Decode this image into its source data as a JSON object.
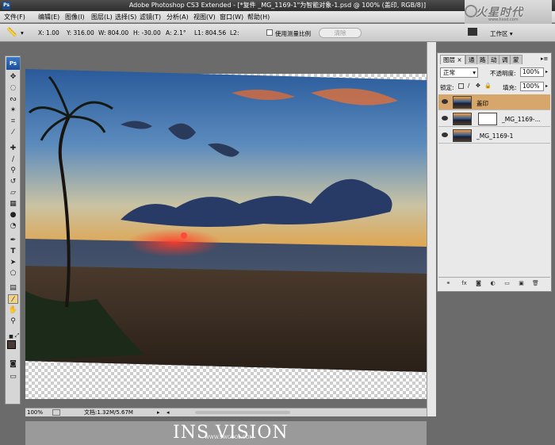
{
  "window": {
    "title": "Adobe Photoshop CS3 Extended - [*复件 _MG_1169-1\"为智能对象-1.psd @ 100% (盖印, RGB/8)]",
    "app_icon": "Ps"
  },
  "menu": [
    "文件(F)",
    "编辑(E)",
    "图像(I)",
    "图层(L)",
    "选择(S)",
    "滤镜(T)",
    "分析(A)",
    "视图(V)",
    "窗口(W)",
    "帮助(H)"
  ],
  "logo": {
    "text": "火星时代",
    "url": "www.hxsd.com"
  },
  "options": {
    "x": "X: 1.00",
    "y": "Y: 316.00",
    "w": "W: 804.00",
    "h": "H: -30.00",
    "a": "A: 2.1°",
    "l1": "L1: 804.56",
    "l2": "L2:",
    "use_scale_label": "使用测量比例",
    "clear_label": "清除",
    "workspace_label": "工作区 ▾"
  },
  "toolbox": {
    "badge": "Ps"
  },
  "panel": {
    "tabs": [
      "图层 ×",
      "通",
      "路",
      "动",
      "调",
      "蒙"
    ],
    "blend_mode": "正常",
    "opacity_label": "不透明度:",
    "opacity_value": "100%",
    "lock_label": "锁定:",
    "fill_label": "填充:",
    "fill_value": "100%",
    "layers": [
      {
        "name": "盖印",
        "selected": true
      },
      {
        "name": "_MG_1169-...",
        "selected": false
      },
      {
        "name": "_MG_1169-1",
        "selected": false
      }
    ]
  },
  "watermark": {
    "text": "INS VISION",
    "sub": "WWW.SWCOOL.COM"
  },
  "status": {
    "zoom": "100%",
    "doc": "文档:1.32M/5.67M"
  }
}
